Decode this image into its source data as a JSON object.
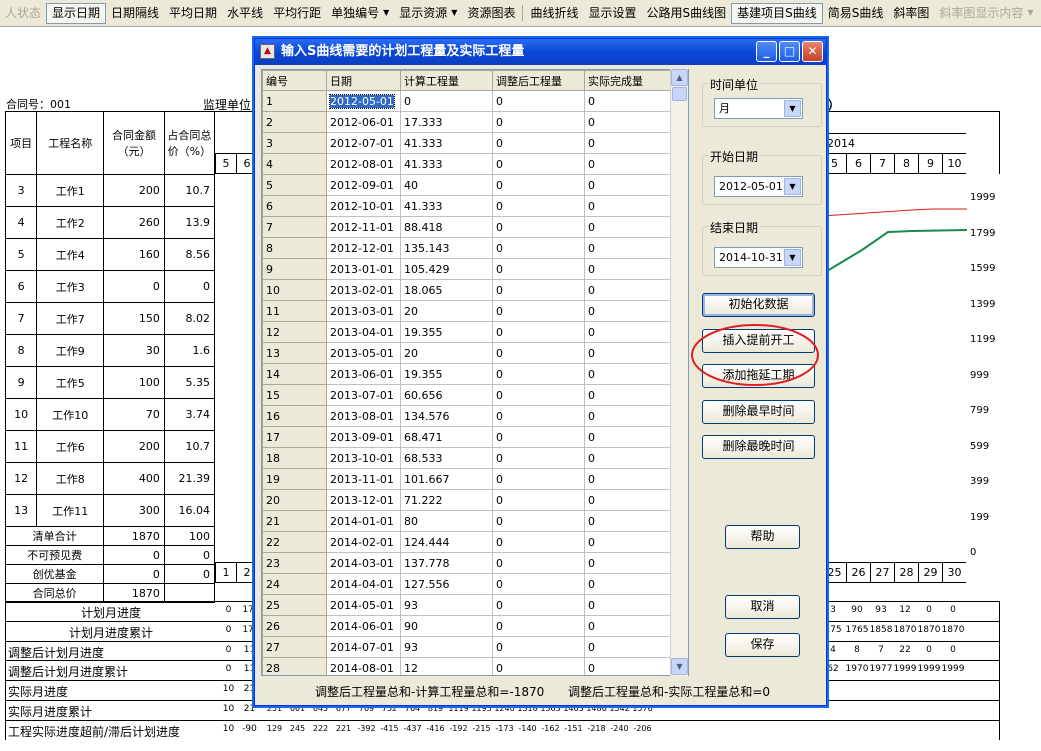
{
  "toolbar": {
    "items": [
      {
        "label": "人状态",
        "disabled": true
      },
      {
        "label": "显示日期",
        "pressed": true
      },
      {
        "label": "日期隔线"
      },
      {
        "label": "平均日期"
      },
      {
        "label": "水平线"
      },
      {
        "label": "平均行距"
      },
      {
        "label": "单独编号",
        "dropdown": true
      },
      {
        "label": "显示资源",
        "dropdown": true
      },
      {
        "label": "资源图表"
      },
      {
        "label": "曲线折线",
        "sep_before": true
      },
      {
        "label": "显示设置"
      },
      {
        "label": "公路用S曲线图"
      },
      {
        "label": "基建项目S曲线",
        "pressed": true
      },
      {
        "label": "简易S曲线"
      },
      {
        "label": "斜率图"
      },
      {
        "label": "斜率图显示内容",
        "disabled": true,
        "dropdown": true
      }
    ]
  },
  "report": {
    "contract_no": "合同号：001",
    "supervisor": "监理单位",
    "right_title_frag": "）",
    "year": "2014",
    "headers": {
      "item": "项目",
      "name": "工程名称",
      "amount": "合同金额（元）",
      "pct": "占合同总价（%）"
    },
    "month_heads_left": [
      "5",
      "6"
    ],
    "month_heads_right": [
      "5",
      "6",
      "7",
      "8",
      "9",
      "10"
    ],
    "rows": [
      {
        "item": "3",
        "name": "工作1",
        "amount": "200",
        "pct": "10.7"
      },
      {
        "item": "4",
        "name": "工作2",
        "amount": "260",
        "pct": "13.9"
      },
      {
        "item": "5",
        "name": "工作4",
        "amount": "160",
        "pct": "8.56"
      },
      {
        "item": "6",
        "name": "工作3",
        "amount": "0",
        "pct": "0"
      },
      {
        "item": "7",
        "name": "工作7",
        "amount": "150",
        "pct": "8.02"
      },
      {
        "item": "8",
        "name": "工作9",
        "amount": "30",
        "pct": "1.6"
      },
      {
        "item": "9",
        "name": "工作5",
        "amount": "100",
        "pct": "5.35"
      },
      {
        "item": "10",
        "name": "工作10",
        "amount": "70",
        "pct": "3.74"
      },
      {
        "item": "11",
        "name": "工作6",
        "amount": "200",
        "pct": "10.7"
      },
      {
        "item": "12",
        "name": "工作8",
        "amount": "400",
        "pct": "21.39"
      },
      {
        "item": "13",
        "name": "工作11",
        "amount": "300",
        "pct": "16.04"
      }
    ],
    "totals": [
      {
        "label": "清单合计",
        "amount": "1870",
        "pct": "100"
      },
      {
        "label": "不可预见费",
        "amount": "0",
        "pct": "0"
      },
      {
        "label": "创优基金",
        "amount": "0",
        "pct": "0"
      },
      {
        "label": "合同总价",
        "amount": "1870",
        "pct": ""
      }
    ],
    "y_axis": [
      "1999",
      "1799",
      "1599",
      "1399",
      "1199",
      "999",
      "799",
      "599",
      "399",
      "199",
      "0"
    ],
    "period_left": [
      "1",
      "2"
    ],
    "period_right": [
      "25",
      "26",
      "27",
      "28",
      "29",
      "30"
    ],
    "bottom_labels": [
      "计划月进度",
      "计划月进度累计",
      "调整后计划月进度",
      "调整后计划月进度累计",
      "实际月进度",
      "实际月进度累计",
      "工程实际进度超前/滞后计划进度"
    ],
    "bottom_left_vals": [
      [
        "0",
        "17."
      ],
      [
        "0",
        "17."
      ],
      [
        "0",
        "11"
      ],
      [
        "0",
        "11"
      ],
      [
        "10",
        "21"
      ],
      [
        "10",
        "21"
      ],
      [
        "10",
        "-90"
      ]
    ],
    "bottom_right_vals": [
      [
        "3",
        "90",
        "93",
        "12",
        "0",
        "0"
      ],
      [
        "175",
        "1765",
        "1858",
        "1870",
        "1870",
        "1870"
      ],
      [
        "4",
        "8",
        "7",
        "22",
        "0",
        "0"
      ],
      [
        "62",
        "1970",
        "1977",
        "1999",
        "1999",
        "1999"
      ],
      [],
      [],
      []
    ],
    "actual_cum_visible": [
      "251",
      "601",
      "645",
      "677",
      "709",
      "752",
      "764",
      "819",
      "1119",
      "1195",
      "1240",
      "1318",
      "1363",
      "1463",
      "1486",
      "1542",
      "1576"
    ],
    "diff_visible": [
      "129",
      "245",
      "222",
      "221",
      "-392",
      "-415",
      "-437",
      "-416",
      "-192",
      "-215",
      "-173",
      "-140",
      "-162",
      "-151",
      "-218",
      "-240",
      "-206"
    ]
  },
  "dialog": {
    "title": "输入S曲线需要的计划工程量及实际工程量",
    "columns": [
      "编号",
      "日期",
      "计算工程量",
      "调整后工程量",
      "实际完成量"
    ],
    "rows": [
      [
        "1",
        "2012-05-01",
        "0",
        "0",
        "0"
      ],
      [
        "2",
        "2012-06-01",
        "17.333",
        "0",
        "0"
      ],
      [
        "3",
        "2012-07-01",
        "41.333",
        "0",
        "0"
      ],
      [
        "4",
        "2012-08-01",
        "41.333",
        "0",
        "0"
      ],
      [
        "5",
        "2012-09-01",
        "40",
        "0",
        "0"
      ],
      [
        "6",
        "2012-10-01",
        "41.333",
        "0",
        "0"
      ],
      [
        "7",
        "2012-11-01",
        "88.418",
        "0",
        "0"
      ],
      [
        "8",
        "2012-12-01",
        "135.143",
        "0",
        "0"
      ],
      [
        "9",
        "2013-01-01",
        "105.429",
        "0",
        "0"
      ],
      [
        "10",
        "2013-02-01",
        "18.065",
        "0",
        "0"
      ],
      [
        "11",
        "2013-03-01",
        "20",
        "0",
        "0"
      ],
      [
        "12",
        "2013-04-01",
        "19.355",
        "0",
        "0"
      ],
      [
        "13",
        "2013-05-01",
        "20",
        "0",
        "0"
      ],
      [
        "14",
        "2013-06-01",
        "19.355",
        "0",
        "0"
      ],
      [
        "15",
        "2013-07-01",
        "60.656",
        "0",
        "0"
      ],
      [
        "16",
        "2013-08-01",
        "134.576",
        "0",
        "0"
      ],
      [
        "17",
        "2013-09-01",
        "68.471",
        "0",
        "0"
      ],
      [
        "18",
        "2013-10-01",
        "68.533",
        "0",
        "0"
      ],
      [
        "19",
        "2013-11-01",
        "101.667",
        "0",
        "0"
      ],
      [
        "20",
        "2013-12-01",
        "71.222",
        "0",
        "0"
      ],
      [
        "21",
        "2014-01-01",
        "80",
        "0",
        "0"
      ],
      [
        "22",
        "2014-02-01",
        "124.444",
        "0",
        "0"
      ],
      [
        "23",
        "2014-03-01",
        "137.778",
        "0",
        "0"
      ],
      [
        "24",
        "2014-04-01",
        "127.556",
        "0",
        "0"
      ],
      [
        "25",
        "2014-05-01",
        "93",
        "0",
        "0"
      ],
      [
        "26",
        "2014-06-01",
        "90",
        "0",
        "0"
      ],
      [
        "27",
        "2014-07-01",
        "93",
        "0",
        "0"
      ],
      [
        "28",
        "2014-08-01",
        "12",
        "0",
        "0"
      ]
    ],
    "time_unit_label": "时间单位",
    "time_unit_value": "月",
    "start_label": "开始日期",
    "start_value": "2012-05-01",
    "end_label": "结束日期",
    "end_value": "2014-10-31",
    "btn_init": "初始化数据",
    "btn_insert_early": "插入提前开工",
    "btn_add_delay": "添加拖延工期",
    "btn_del_earliest": "删除最早时间",
    "btn_del_latest": "删除最晚时间",
    "btn_help": "帮助",
    "btn_cancel": "取消",
    "btn_save": "保存",
    "status_left": "调整后工程量总和-计算工程量总和=-1870",
    "status_right": "调整后工程量总和-实际工程量总和=0",
    "min_symbol": "_",
    "max_symbol": "□",
    "close_symbol": "✕"
  },
  "colors": {
    "annotation": "#e02020",
    "plan_line": "#d02020",
    "actual_line": "#1a8a4a"
  }
}
